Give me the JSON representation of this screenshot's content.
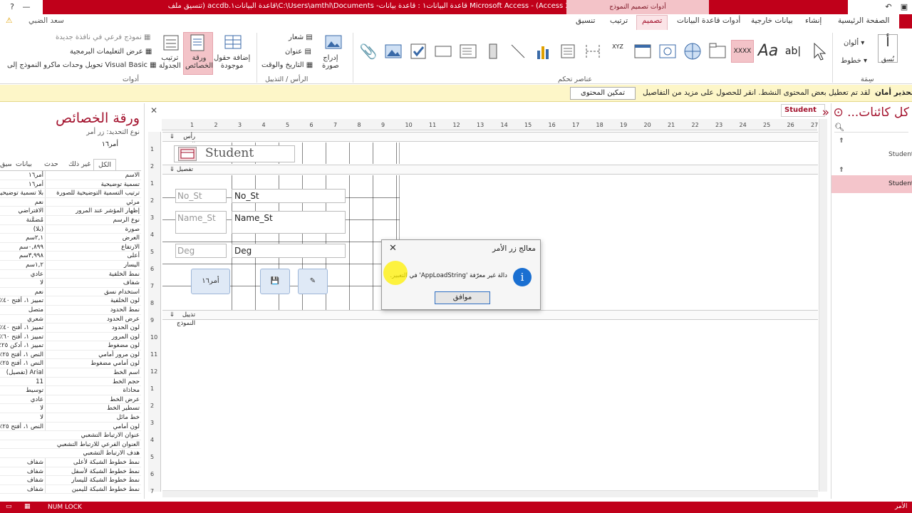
{
  "window": {
    "title": "Microsoft Access  - (Access 2007 - 2013 قاعدة البيانات١ : قاعدة بيانات- C:\\Users\\amthl\\Documents\\قاعدة البيانات١.accdb (تنسيق ملف",
    "context_tab": "أدوات تصميم النموذج",
    "min": "—",
    "restore": "❐",
    "close": "✕",
    "help": "?",
    "undo": "↶",
    "user": "سعد الضبي"
  },
  "tabs": [
    "الصفحة الرئيسية",
    "إنشاء",
    "بيانات خارجية",
    "أدوات قاعدة البيانات",
    "تصميم",
    "ترتيب",
    "تنسيق"
  ],
  "ribbon": {
    "groups": {
      "views": "سِمَة",
      "controls": "عناصر تحكم",
      "header_footer": "الرأس / التذييل",
      "tools": "أدوات"
    },
    "theme": {
      "colors": "ألوان",
      "fonts": "خطوط"
    },
    "header_footer": {
      "logo": "شعار",
      "title": "عنوان",
      "datetime": "التاريخ والوقت",
      "insert_image": "إدراج\nصورة"
    },
    "tools": {
      "add_fields": "إضافة حقول\nموجودة",
      "property_sheet": "ورقة\nالخصائص",
      "tab_order": "ترتيب\nالجدولة",
      "subform": "نموذج فرعي في نافذة جديدة",
      "view_code": "عرض التعليمات البرمجية",
      "convert_macros": "تحويل وحدات ماكرو النموذج إلى Visual Basic"
    },
    "controls_text": {
      "xyz": "XYZ",
      "aa": "Aa",
      "abl": "ab|",
      "xxxx": "XXXX"
    }
  },
  "security": {
    "label": "تحذير أمان",
    "message": "لقد تم تعطيل بعض المحتوى النشط. انقر للحصول على مزيد من التفاصيل.",
    "button": "تمكين المحتوى"
  },
  "property_sheet": {
    "title": "ورقة الخصائص",
    "selection_type": "نوع التحديد: زر أمر",
    "selection_name": "أمر١٦",
    "tabs": [
      "الكل",
      "غير ذلك",
      "حدث",
      "بيانات",
      "تنسيق"
    ],
    "rows": [
      [
        "الاسم",
        "أمر١٦"
      ],
      [
        "تسمية توضيحية",
        "أمر١٦"
      ],
      [
        "ترتيب التسمية التوضيحية للصورة",
        "بلا تسمية توضيحية"
      ],
      [
        "مرئي",
        "نعم"
      ],
      [
        "إظهار المؤشر عند المرور",
        "الافتراضي"
      ],
      [
        "نوع الرسم",
        "مُضمَّنة"
      ],
      [
        "صورة",
        "(بلا)"
      ],
      [
        "العرض",
        "٢,١سم"
      ],
      [
        "الارتفاع",
        "٠,٨٩٩سم"
      ],
      [
        "أعلى",
        "٣,٩٩٨سم"
      ],
      [
        "اليسار",
        "١,٢سم"
      ],
      [
        "نمط الخلفية",
        "عادي"
      ],
      [
        "شفاف",
        "لا"
      ],
      [
        "استخدام نسق",
        "نعم"
      ],
      [
        "لون الخلفية",
        "تمييز ١، أفتح ٤٠٪"
      ],
      [
        "نمط الحدود",
        "متصل"
      ],
      [
        "عرض الحدود",
        "شعري"
      ],
      [
        "لون الحدود",
        "تمييز ١، أفتح ٤٠٪"
      ],
      [
        "لون المرور",
        "تمييز ١، أفتح ٦٠٪"
      ],
      [
        "لون مضغوط",
        "تمييز ١، أدكن ٢٥٪"
      ],
      [
        "لون مرور أمامي",
        "النص ١، أفتح ٢٥٪"
      ],
      [
        "لون أمامي مضغوط",
        "النص ١، أفتح ٢٥٪"
      ],
      [
        "اسم الخط",
        "Arial (تفصيل)"
      ],
      [
        "حجم الخط",
        "11"
      ],
      [
        "محاذاة",
        "توسيط"
      ],
      [
        "عرض الخط",
        "عادي"
      ],
      [
        "تسطير الخط",
        "لا"
      ],
      [
        "خط مائل",
        "لا"
      ],
      [
        "لون أمامي",
        "النص ١، أفتح ٢٥٪"
      ],
      [
        "عنوان الارتباط التشعبي",
        ""
      ],
      [
        "العنوان الفرعي للارتباط التشعبي",
        ""
      ],
      [
        "هدف الارتباط التشعبي",
        ""
      ],
      [
        "نمط خطوط الشبكة لأعلى",
        "شفاف"
      ],
      [
        "نمط خطوط الشبكة لأسفل",
        "شفاف"
      ],
      [
        "نمط خطوط الشبكة لليسار",
        "شفاف"
      ],
      [
        "نمط خطوط الشبكة لليمين",
        "شفاف"
      ]
    ]
  },
  "design": {
    "doc_tab": "Student",
    "ruler": [
      "1",
      "2",
      "3",
      "4",
      "5",
      "6",
      "7",
      "8",
      "9",
      "10",
      "11",
      "12",
      "13",
      "14",
      "15",
      "16",
      "17",
      "18",
      "19",
      "20",
      "21",
      "22",
      "23",
      "24",
      "25",
      "26",
      "27"
    ],
    "vruler": [
      "1",
      "2",
      "1",
      "2",
      "3",
      "4",
      "5",
      "6",
      "7",
      "8",
      "9",
      "10",
      "11",
      "12",
      "1",
      "2",
      "3",
      "4",
      "5",
      "6",
      "7"
    ],
    "sections": {
      "header": "رأس النموذج",
      "detail": "تفصيل",
      "footer": "تذييل النموذج"
    },
    "form_title": "Student",
    "fields": [
      {
        "label": "No_St",
        "value": "No_St"
      },
      {
        "label": "Name_St",
        "value": "Name_St"
      },
      {
        "label": "Deg",
        "value": "Deg"
      }
    ],
    "buttons": {
      "command16": "أمر١٦",
      "save": "💾",
      "edit": "✎"
    }
  },
  "nav": {
    "title": "كل كائنات...",
    "items": [
      "Student",
      "Student"
    ]
  },
  "dialog": {
    "title": "معالج زر الأمر",
    "message": "دالة غير معرّفة 'AppLoadString' في التعبير.",
    "ok": "موافق",
    "info": "i"
  },
  "status": {
    "num_lock": "NUM LOCK",
    "left_text": "الأمر"
  }
}
